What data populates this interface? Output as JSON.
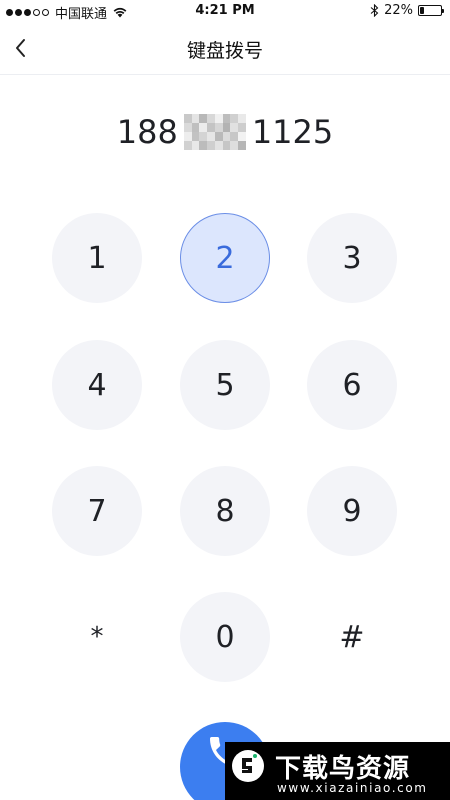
{
  "status_bar": {
    "carrier": "中国联通",
    "time": "4:21 PM",
    "battery": "22%",
    "battery_level": 0.22,
    "signal_filled": 3,
    "signal_total": 5
  },
  "nav": {
    "title": "键盘拨号",
    "back_icon": "chevron-left-icon"
  },
  "number": {
    "prefix": "188",
    "masked": true,
    "suffix": "1125"
  },
  "keypad": {
    "keys": [
      "1",
      "2",
      "3",
      "4",
      "5",
      "6",
      "7",
      "8",
      "9",
      "*",
      "0",
      "#"
    ],
    "active_key": "2"
  },
  "call": {
    "icon": "phone-icon",
    "color": "#3c7ef0"
  },
  "watermark": {
    "cn": "下载鸟资源",
    "en": "www.xiazainiao.com"
  },
  "colors": {
    "key_bg": "#f3f4f8",
    "key_active_bg": "#dce6fd",
    "key_active_text": "#3a6bdc"
  }
}
